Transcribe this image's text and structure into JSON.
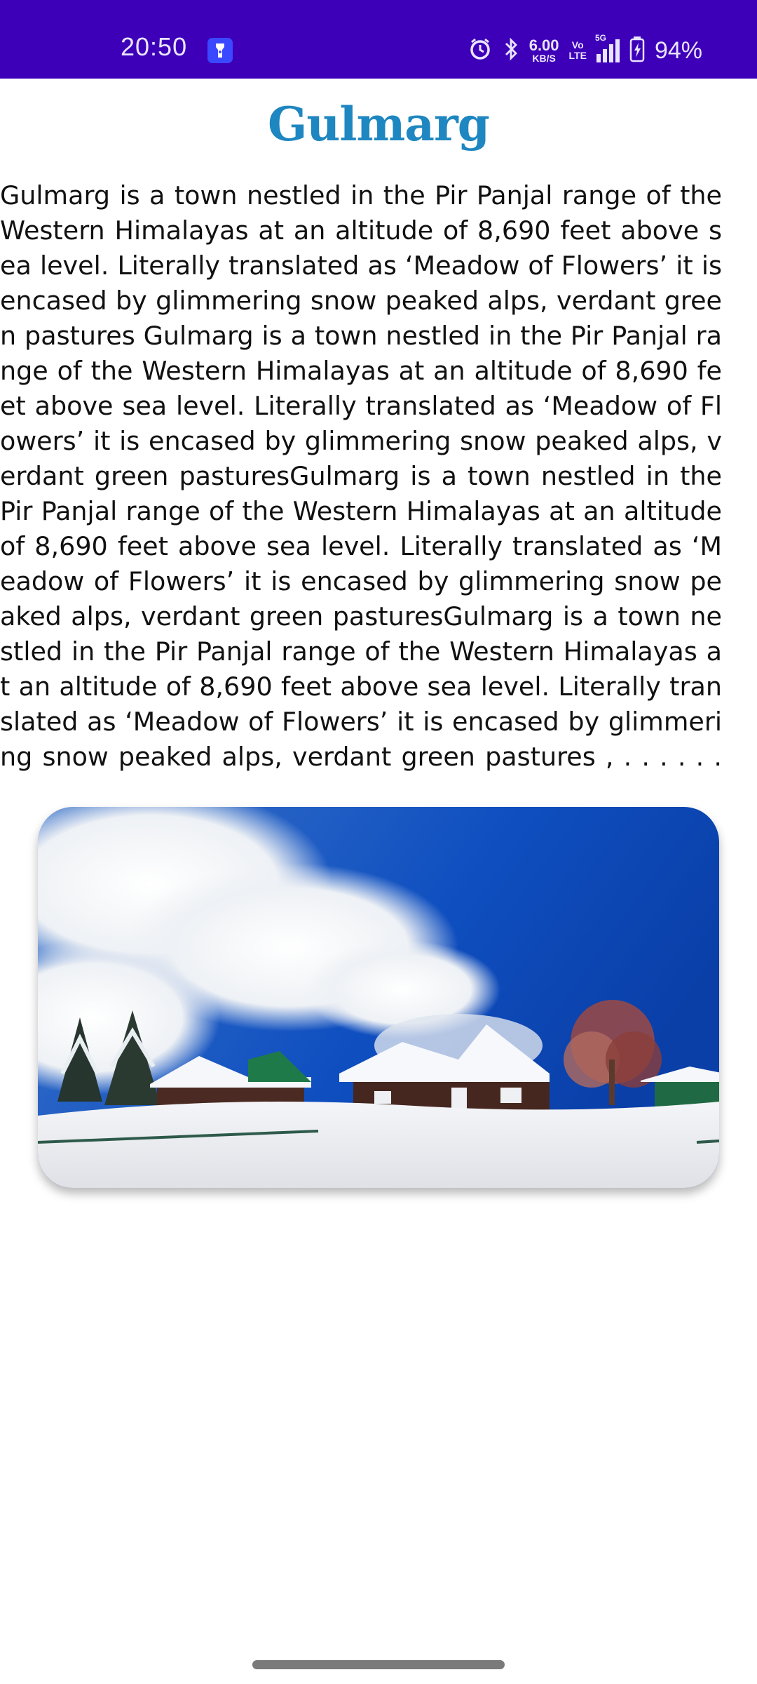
{
  "status_bar": {
    "time": "20:50",
    "net_speed_value": "6.00",
    "net_speed_unit": "KB/S",
    "volte_top": "Vo",
    "volte_bottom": "LTE",
    "network": "5G",
    "battery": "94%",
    "icons": [
      "torch-app-icon",
      "alarm-icon",
      "bluetooth-icon",
      "signal-icon",
      "battery-charging-icon"
    ],
    "background_color": "#3d00b8"
  },
  "page": {
    "title": "Gulmarg",
    "title_color": "#1e86c0",
    "description": "Gulmarg is a town nestled in the Pir Panjal range of the Western Himalayas at an altitude of 8,690 feet above sea level. Literally translated as ‘Meadow of Flowers’ it is encased by glimmering snow peaked alps, verdant green pastures Gulmarg is a town nestled in the Pir Panjal range of the Western Himalayas at an altitude of 8,690 feet above sea level. Literally translated as ‘Meadow of Flowers’ it is encased by glimmering snow peaked alps, verdant green pasturesGulmarg is a town nestled in the Pir Panjal range of the Western Himalayas at an altitude of 8,690 feet above sea level. Literally translated as ‘Meadow of Flowers’ it is encased by glimmering snow peaked alps, verdant green pasturesGulmarg is a town nestled in the Pir Panjal range of the Western Himalayas at an altitude of 8,690 feet above sea level. Literally translated as ‘Meadow of Flowers’ it is encased by glimmering snow peaked alps, verdant green pastures , . . . . . .",
    "image": {
      "depicts": "snow-covered chalets under blue sky",
      "icon": "landscape-photo"
    }
  }
}
